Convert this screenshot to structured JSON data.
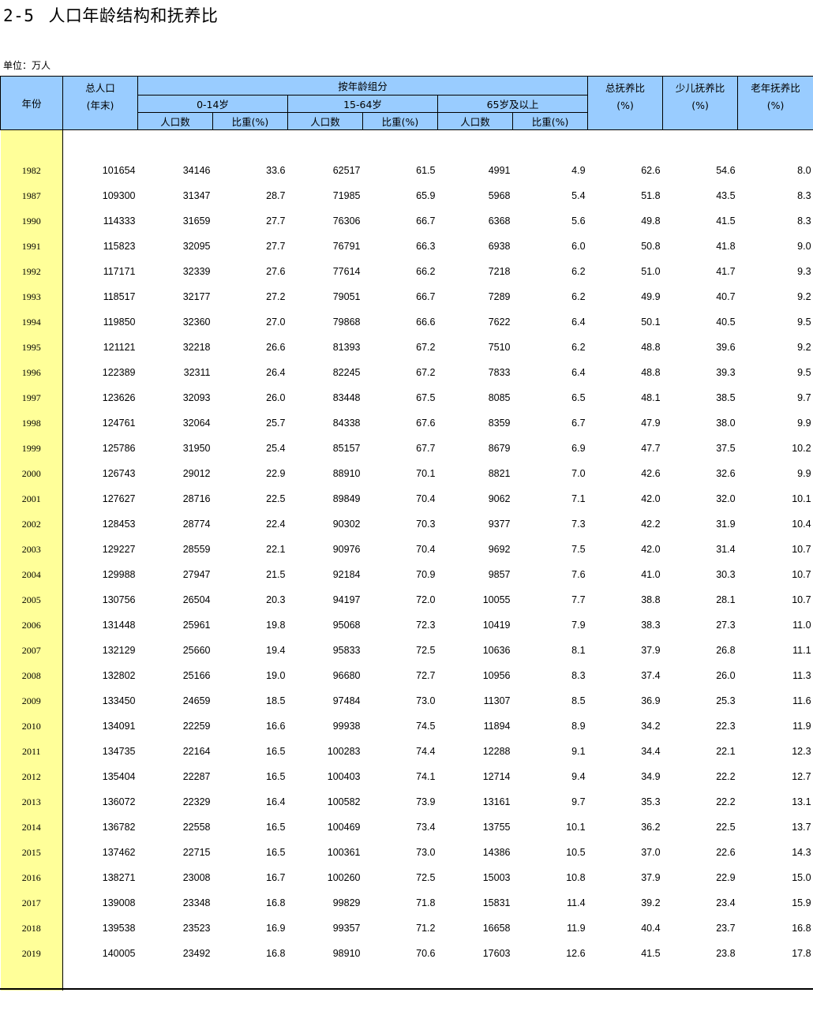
{
  "title": {
    "number": "2-5",
    "text": "人口年龄结构和抚养比"
  },
  "unit": "单位：万人",
  "headers": {
    "year": "年份",
    "total_line1": "总人口",
    "total_line2": "(年末)",
    "age_group": "按年龄组分",
    "group_0_14": "0-14岁",
    "group_15_64": "15-64岁",
    "group_65": "65岁及以上",
    "pop": "人口数",
    "share": "比重(%)",
    "total_dep": "总抚养比",
    "child_dep": "少儿抚养比",
    "old_dep": "老年抚养比",
    "pct": "(%)"
  },
  "rows": [
    [
      "1982",
      "101654",
      "34146",
      "33.6",
      "62517",
      "61.5",
      "4991",
      "4.9",
      "62.6",
      "54.6",
      "8.0"
    ],
    [
      "1987",
      "109300",
      "31347",
      "28.7",
      "71985",
      "65.9",
      "5968",
      "5.4",
      "51.8",
      "43.5",
      "8.3"
    ],
    [
      "1990",
      "114333",
      "31659",
      "27.7",
      "76306",
      "66.7",
      "6368",
      "5.6",
      "49.8",
      "41.5",
      "8.3"
    ],
    [
      "1991",
      "115823",
      "32095",
      "27.7",
      "76791",
      "66.3",
      "6938",
      "6.0",
      "50.8",
      "41.8",
      "9.0"
    ],
    [
      "1992",
      "117171",
      "32339",
      "27.6",
      "77614",
      "66.2",
      "7218",
      "6.2",
      "51.0",
      "41.7",
      "9.3"
    ],
    [
      "1993",
      "118517",
      "32177",
      "27.2",
      "79051",
      "66.7",
      "7289",
      "6.2",
      "49.9",
      "40.7",
      "9.2"
    ],
    [
      "1994",
      "119850",
      "32360",
      "27.0",
      "79868",
      "66.6",
      "7622",
      "6.4",
      "50.1",
      "40.5",
      "9.5"
    ],
    [
      "1995",
      "121121",
      "32218",
      "26.6",
      "81393",
      "67.2",
      "7510",
      "6.2",
      "48.8",
      "39.6",
      "9.2"
    ],
    [
      "1996",
      "122389",
      "32311",
      "26.4",
      "82245",
      "67.2",
      "7833",
      "6.4",
      "48.8",
      "39.3",
      "9.5"
    ],
    [
      "1997",
      "123626",
      "32093",
      "26.0",
      "83448",
      "67.5",
      "8085",
      "6.5",
      "48.1",
      "38.5",
      "9.7"
    ],
    [
      "1998",
      "124761",
      "32064",
      "25.7",
      "84338",
      "67.6",
      "8359",
      "6.7",
      "47.9",
      "38.0",
      "9.9"
    ],
    [
      "1999",
      "125786",
      "31950",
      "25.4",
      "85157",
      "67.7",
      "8679",
      "6.9",
      "47.7",
      "37.5",
      "10.2"
    ],
    [
      "2000",
      "126743",
      "29012",
      "22.9",
      "88910",
      "70.1",
      "8821",
      "7.0",
      "42.6",
      "32.6",
      "9.9"
    ],
    [
      "2001",
      "127627",
      "28716",
      "22.5",
      "89849",
      "70.4",
      "9062",
      "7.1",
      "42.0",
      "32.0",
      "10.1"
    ],
    [
      "2002",
      "128453",
      "28774",
      "22.4",
      "90302",
      "70.3",
      "9377",
      "7.3",
      "42.2",
      "31.9",
      "10.4"
    ],
    [
      "2003",
      "129227",
      "28559",
      "22.1",
      "90976",
      "70.4",
      "9692",
      "7.5",
      "42.0",
      "31.4",
      "10.7"
    ],
    [
      "2004",
      "129988",
      "27947",
      "21.5",
      "92184",
      "70.9",
      "9857",
      "7.6",
      "41.0",
      "30.3",
      "10.7"
    ],
    [
      "2005",
      "130756",
      "26504",
      "20.3",
      "94197",
      "72.0",
      "10055",
      "7.7",
      "38.8",
      "28.1",
      "10.7"
    ],
    [
      "2006",
      "131448",
      "25961",
      "19.8",
      "95068",
      "72.3",
      "10419",
      "7.9",
      "38.3",
      "27.3",
      "11.0"
    ],
    [
      "2007",
      "132129",
      "25660",
      "19.4",
      "95833",
      "72.5",
      "10636",
      "8.1",
      "37.9",
      "26.8",
      "11.1"
    ],
    [
      "2008",
      "132802",
      "25166",
      "19.0",
      "96680",
      "72.7",
      "10956",
      "8.3",
      "37.4",
      "26.0",
      "11.3"
    ],
    [
      "2009",
      "133450",
      "24659",
      "18.5",
      "97484",
      "73.0",
      "11307",
      "8.5",
      "36.9",
      "25.3",
      "11.6"
    ],
    [
      "2010",
      "134091",
      "22259",
      "16.6",
      "99938",
      "74.5",
      "11894",
      "8.9",
      "34.2",
      "22.3",
      "11.9"
    ],
    [
      "2011",
      "134735",
      "22164",
      "16.5",
      "100283",
      "74.4",
      "12288",
      "9.1",
      "34.4",
      "22.1",
      "12.3"
    ],
    [
      "2012",
      "135404",
      "22287",
      "16.5",
      "100403",
      "74.1",
      "12714",
      "9.4",
      "34.9",
      "22.2",
      "12.7"
    ],
    [
      "2013",
      "136072",
      "22329",
      "16.4",
      "100582",
      "73.9",
      "13161",
      "9.7",
      "35.3",
      "22.2",
      "13.1"
    ],
    [
      "2014",
      "136782",
      "22558",
      "16.5",
      "100469",
      "73.4",
      "13755",
      "10.1",
      "36.2",
      "22.5",
      "13.7"
    ],
    [
      "2015",
      "137462",
      "22715",
      "16.5",
      "100361",
      "73.0",
      "14386",
      "10.5",
      "37.0",
      "22.6",
      "14.3"
    ],
    [
      "2016",
      "138271",
      "23008",
      "16.7",
      "100260",
      "72.5",
      "15003",
      "10.8",
      "37.9",
      "22.9",
      "15.0"
    ],
    [
      "2017",
      "139008",
      "23348",
      "16.8",
      "99829",
      "71.8",
      "15831",
      "11.4",
      "39.2",
      "23.4",
      "15.9"
    ],
    [
      "2018",
      "139538",
      "23523",
      "16.9",
      "99357",
      "71.2",
      "16658",
      "11.9",
      "40.4",
      "23.7",
      "16.8"
    ],
    [
      "2019",
      "140005",
      "23492",
      "16.8",
      "98910",
      "70.6",
      "17603",
      "12.6",
      "41.5",
      "23.8",
      "17.8"
    ]
  ]
}
